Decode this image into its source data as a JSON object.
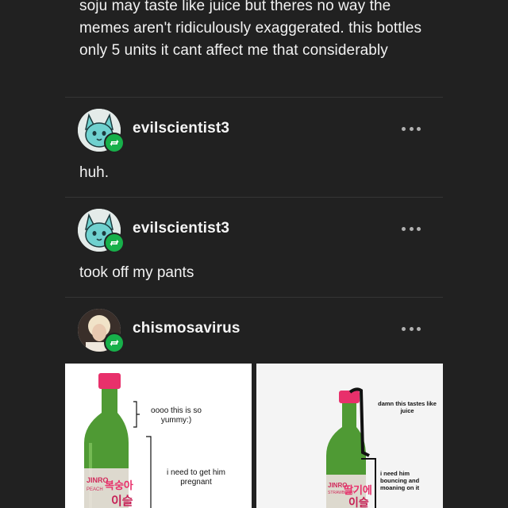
{
  "intro_text": "soju may taste like juice but theres no way the memes aren't ridiculously exaggerated. this bottles only 5 units it cant affect me that considerably",
  "posts": [
    {
      "username": "evilscientist3",
      "text": "huh."
    },
    {
      "username": "evilscientist3",
      "text": "took off my  pants"
    },
    {
      "username": "chismosavirus",
      "text": ""
    }
  ],
  "meme": {
    "left": {
      "caption_top": "oooo this is so yummy:)",
      "caption_bottom": "i need to get him pregnant",
      "bottle_brand": "JINRO",
      "bottle_flavor": "PEACH",
      "bottle_korean": "복숭아에 이슬"
    },
    "right": {
      "caption_top": "damn this tastes like juice",
      "caption_bottom": "i need him bouncing and moaning on it",
      "bottle_brand": "JINRO",
      "bottle_flavor": "STRAWBERRY",
      "bottle_korean": "딸기에 이슬"
    }
  },
  "colors": {
    "background": "#212121",
    "reblog_green": "#17b04a",
    "divider": "#353535"
  }
}
